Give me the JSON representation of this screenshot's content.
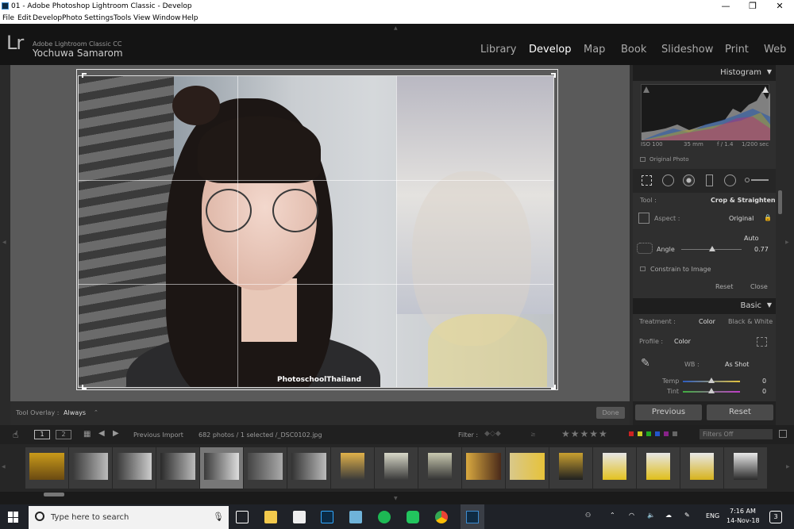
{
  "window": {
    "title": "01 - Adobe Photoshop Lightroom Classic - Develop"
  },
  "menu": [
    "File",
    "Edit",
    "Develop",
    "Photo",
    "Settings",
    "Tools",
    "View",
    "Window",
    "Help"
  ],
  "identity": {
    "logo": "Lr",
    "product": "Adobe Lightroom Classic CC",
    "user": "Yochuwa Samarom"
  },
  "modules": [
    "Library",
    "Develop",
    "Map",
    "Book",
    "Slideshow",
    "Print",
    "Web"
  ],
  "active_module": "Develop",
  "photo": {
    "watermark": "PhotoschoolThailand"
  },
  "toolbar": {
    "overlay_label": "Tool Overlay :",
    "overlay_value": "Always",
    "done": "Done"
  },
  "histogram": {
    "title": "Histogram",
    "iso": "ISO 100",
    "focal": "35 mm",
    "aperture": "f / 1.4",
    "shutter": "1/200 sec",
    "original_photo": "Original Photo"
  },
  "crop": {
    "tool_label": "Tool :",
    "tool_value": "Crop & Straighten",
    "aspect_label": "Aspect :",
    "aspect_value": "Original",
    "auto": "Auto",
    "angle_label": "Angle",
    "angle_value": "0.77",
    "constrain": "Constrain to Image",
    "reset": "Reset",
    "close": "Close"
  },
  "basic": {
    "title": "Basic",
    "treatment_label": "Treatment :",
    "color": "Color",
    "bw": "Black & White",
    "profile_label": "Profile :",
    "profile_value": "Color",
    "wb_label": "WB :",
    "wb_value": "As Shot",
    "temp_label": "Temp",
    "temp_value": "0",
    "tint_label": "Tint",
    "tint_value": "0"
  },
  "buttons": {
    "previous": "Previous",
    "reset": "Reset"
  },
  "filmbar": {
    "page1": "1",
    "page2": "2",
    "source": "Previous Import",
    "count": "682 photos / 1 selected /_DSC0102.jpg",
    "filter_label": "Filter :",
    "filters_off": "Filters Off"
  },
  "taskbar": {
    "search_placeholder": "Type here to search",
    "lang": "ENG",
    "time": "7:16 AM",
    "date": "14-Nov-18",
    "notif_count": "3"
  },
  "colors": {
    "accent": "#ffffff",
    "panel": "#2f2f2f",
    "header": "#1e1e1e",
    "ps_blue": "#31a8ff"
  }
}
